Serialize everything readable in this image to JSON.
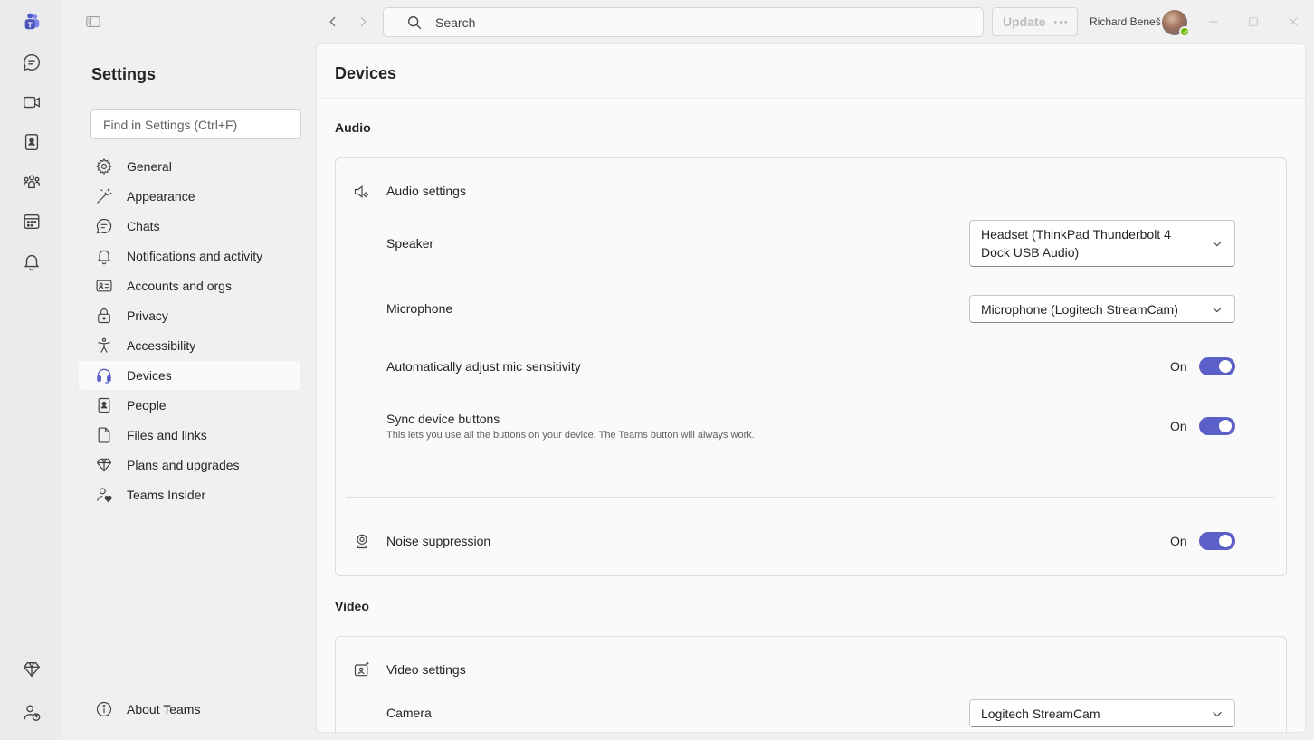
{
  "window": {
    "search_placeholder": "Search",
    "update_label": "Update",
    "update_more": "···",
    "user_name": "Richard Beneš"
  },
  "settings": {
    "title": "Settings",
    "find_placeholder": "Find in Settings (Ctrl+F)",
    "nav": [
      {
        "label": "General",
        "icon": "gear-icon"
      },
      {
        "label": "Appearance",
        "icon": "magic-wand-icon"
      },
      {
        "label": "Chats",
        "icon": "chat-icon"
      },
      {
        "label": "Notifications and activity",
        "icon": "bell-icon"
      },
      {
        "label": "Accounts and orgs",
        "icon": "contact-card-icon"
      },
      {
        "label": "Privacy",
        "icon": "lock-icon"
      },
      {
        "label": "Accessibility",
        "icon": "accessibility-icon"
      },
      {
        "label": "Devices",
        "icon": "headset-icon"
      },
      {
        "label": "People",
        "icon": "people-book-icon"
      },
      {
        "label": "Files and links",
        "icon": "document-icon"
      },
      {
        "label": "Plans and upgrades",
        "icon": "diamond-icon"
      },
      {
        "label": "Teams Insider",
        "icon": "person-heart-icon"
      }
    ],
    "active": "Devices",
    "about": "About Teams"
  },
  "devices": {
    "title": "Devices",
    "audio_heading": "Audio",
    "audio_settings_label": "Audio settings",
    "speaker_label": "Speaker",
    "speaker_value": "Headset (ThinkPad Thunderbolt 4 Dock USB Audio)",
    "microphone_label": "Microphone",
    "microphone_value": "Microphone (Logitech StreamCam)",
    "auto_adjust_label": "Automatically adjust mic sensitivity",
    "auto_adjust_state": "On",
    "sync_buttons_label": "Sync device buttons",
    "sync_buttons_desc": "This lets you use all the buttons on your device. The Teams button will always work.",
    "sync_buttons_state": "On",
    "noise_label": "Noise suppression",
    "noise_state": "On",
    "video_heading": "Video",
    "video_settings_label": "Video settings",
    "camera_label": "Camera",
    "camera_value": "Logitech StreamCam"
  },
  "colors": {
    "accent": "#5b5fc7",
    "presence": "#6bb700"
  }
}
